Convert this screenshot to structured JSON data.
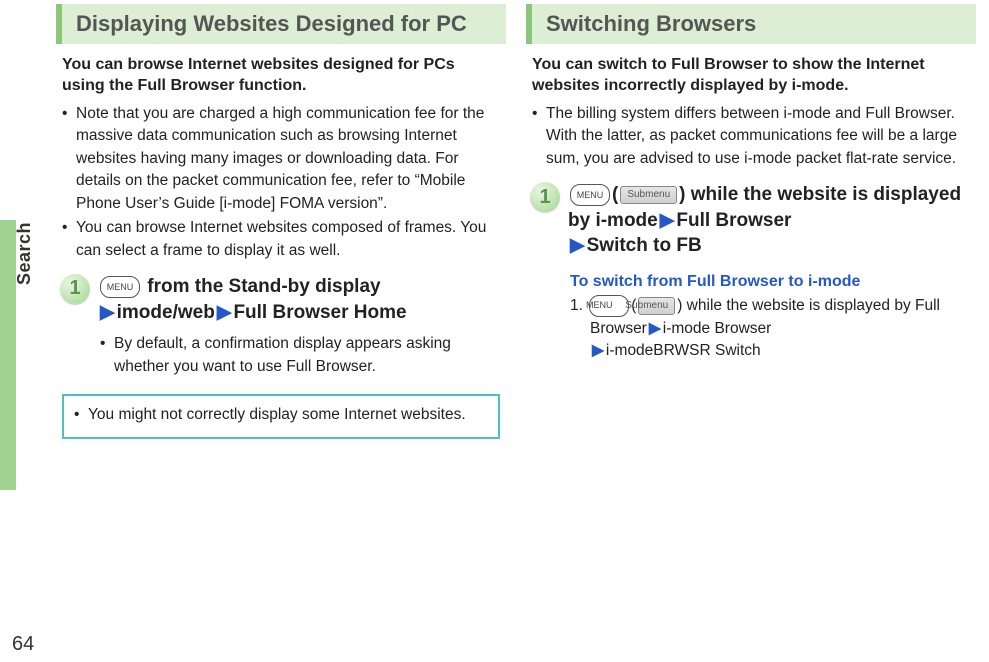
{
  "sidebar": {
    "label": "Search",
    "page_number": "64"
  },
  "left": {
    "header": "Displaying Websites Designed for PC",
    "intro": "You can browse Internet websites designed for PCs using the Full Browser function.",
    "bullets": [
      "Note that you are charged a high communication fee for the massive data communication such as browsing Internet websites having many images or downloading data. For details on the packet communication fee, refer to “Mobile Phone User’s Guide [i-mode] FOMA version”.",
      "You can browse Internet websites composed of frames. You can select a frame to display it as well."
    ],
    "step_num": "1",
    "step_menu_icon": "MENU",
    "step_parts": {
      "a": " from the Stand-by display",
      "b": "imode/web",
      "c": "Full Browser Home"
    },
    "step_sub_bullet": "By default, a confirmation display appears asking whether you want to use Full Browser.",
    "info_box": "You might not correctly display some Internet websites."
  },
  "right": {
    "header": "Switching Browsers",
    "intro": "You can switch to Full Browser to show the Internet websites incorrectly displayed by i-mode.",
    "bullet": "The billing system differs between i-mode and Full Browser. With the latter, as packet communications fee will be a large sum, you are advised to use i-mode packet flat-rate service.",
    "step_num": "1",
    "step_menu_icon": "MENU",
    "step_submenu_icon": "Submenu",
    "step_parts": {
      "a": ") while the website is displayed by i-mode",
      "b": "Full Browser",
      "c": "Switch to FB"
    },
    "sub_heading": "To switch from Full Browser to i-mode",
    "sub_step_prefix": "1. ",
    "sub_step_menu_icon": "MENU",
    "sub_step_submenu_icon": "Submenu",
    "sub_step_parts": {
      "a": ") while the website is displayed by Full Browser",
      "b": "i-mode Browser",
      "c": "i-modeBRWSR Switch"
    }
  }
}
